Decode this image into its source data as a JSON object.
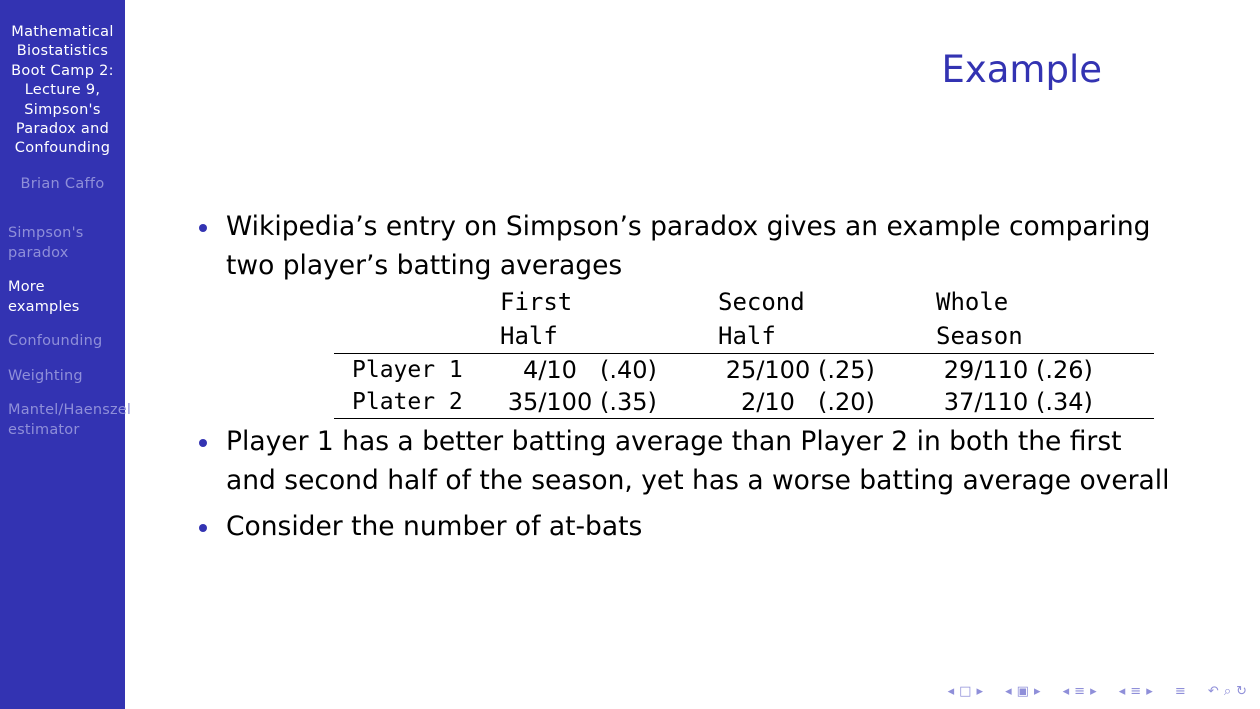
{
  "sidebar": {
    "deck_title_lines": [
      "Mathematical",
      "Biostatistics",
      "Boot Camp 2:",
      "Lecture 9,",
      "Simpson's",
      "Paradox and",
      "Confounding"
    ],
    "author": "Brian Caffo",
    "sections": [
      {
        "lines": [
          "Simpson's",
          "paradox"
        ],
        "active": false
      },
      {
        "lines": [
          "More",
          "examples"
        ],
        "active": true
      },
      {
        "lines": [
          "Confounding"
        ],
        "active": false
      },
      {
        "lines": [
          "Weighting"
        ],
        "active": false
      },
      {
        "lines": [
          "Mantel/Haenszel",
          "estimator"
        ],
        "active": false
      }
    ]
  },
  "frame": {
    "title": "Example",
    "bullets": [
      "Wikipedia’s entry on Simpson’s paradox gives an example comparing two player’s batting averages",
      "Player 1 has a better batting average than Player 2 in both the first and second half of the season, yet has a worse batting average overall",
      "Consider the number of at-bats"
    ]
  },
  "table": {
    "headers": [
      [
        "First",
        "Half"
      ],
      [
        "Second",
        "Half"
      ],
      [
        "Whole",
        "Season"
      ]
    ],
    "rows": [
      {
        "player": "Player 1",
        "cells": [
          {
            "frac": "4/10",
            "avg": "(.40)"
          },
          {
            "frac": "25/100",
            "avg": "(.25)"
          },
          {
            "frac": "29/110",
            "avg": "(.26)"
          }
        ]
      },
      {
        "player": "Plater 2",
        "cells": [
          {
            "frac": "35/100",
            "avg": "(.35)"
          },
          {
            "frac": "2/10",
            "avg": "(.20)"
          },
          {
            "frac": "37/110",
            "avg": "(.34)"
          }
        ]
      }
    ]
  },
  "footer_nav": {
    "icons": [
      "nav-left-icon",
      "frame-icon",
      "nav-right-icon",
      "nav-left-icon",
      "subsection-icon",
      "nav-right-icon",
      "nav-left-icon",
      "section-icon",
      "nav-right-icon",
      "nav-left-icon",
      "section-list-icon",
      "nav-right-icon",
      "align-icon",
      "back-icon",
      "search-icon",
      "refresh-icon"
    ]
  },
  "colors": {
    "accent": "#3333b2",
    "sidebar_dim": "#8f8fd9",
    "bullet": "#3333b2"
  }
}
